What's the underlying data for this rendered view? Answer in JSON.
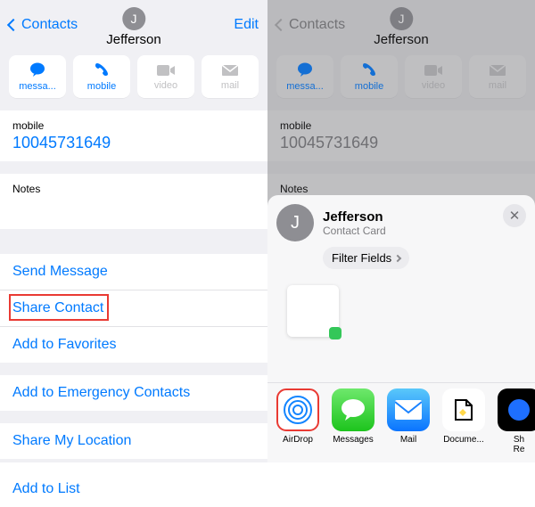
{
  "left": {
    "nav": {
      "back": "Contacts",
      "title": "Jefferson",
      "edit": "Edit",
      "initial": "J"
    },
    "quick": [
      {
        "label": "messa...",
        "icon": "💬",
        "state": "active"
      },
      {
        "label": "mobile",
        "icon": "📞",
        "state": "active"
      },
      {
        "label": "video",
        "icon": "■",
        "state": "inactive"
      },
      {
        "label": "mail",
        "icon": "✉",
        "state": "inactive"
      }
    ],
    "mobile": {
      "label": "mobile",
      "value": "10045731649"
    },
    "notes": "Notes",
    "rows1": [
      {
        "label": "Send Message"
      },
      {
        "label": "Share Contact",
        "highlight": true
      },
      {
        "label": "Add to Favorites"
      }
    ],
    "rows2": [
      {
        "label": "Add to Emergency Contacts"
      }
    ],
    "rows3": [
      {
        "label": "Share My Location"
      }
    ],
    "rows4": [
      {
        "label": "Add to List"
      }
    ]
  },
  "right": {
    "nav": {
      "back": "Contacts",
      "title": "Jefferson",
      "initial": "J"
    },
    "quick": [
      {
        "label": "messa...",
        "state": "active"
      },
      {
        "label": "mobile",
        "state": "active"
      },
      {
        "label": "video",
        "state": "inactive"
      },
      {
        "label": "mail",
        "state": "inactive"
      }
    ],
    "mobile": {
      "label": "mobile",
      "value": "10045731649"
    },
    "notes": "Notes",
    "sheet": {
      "name": "Jefferson",
      "sub": "Contact Card",
      "initial": "J",
      "filter": "Filter Fields",
      "apps": [
        {
          "label": "AirDrop",
          "kind": "airdrop",
          "highlight": true
        },
        {
          "label": "Messages",
          "kind": "msg"
        },
        {
          "label": "Mail",
          "kind": "mail"
        },
        {
          "label": "Docume...",
          "kind": "doc"
        },
        {
          "label": "Sh",
          "kind": "sh",
          "sub": "Re"
        }
      ]
    }
  }
}
